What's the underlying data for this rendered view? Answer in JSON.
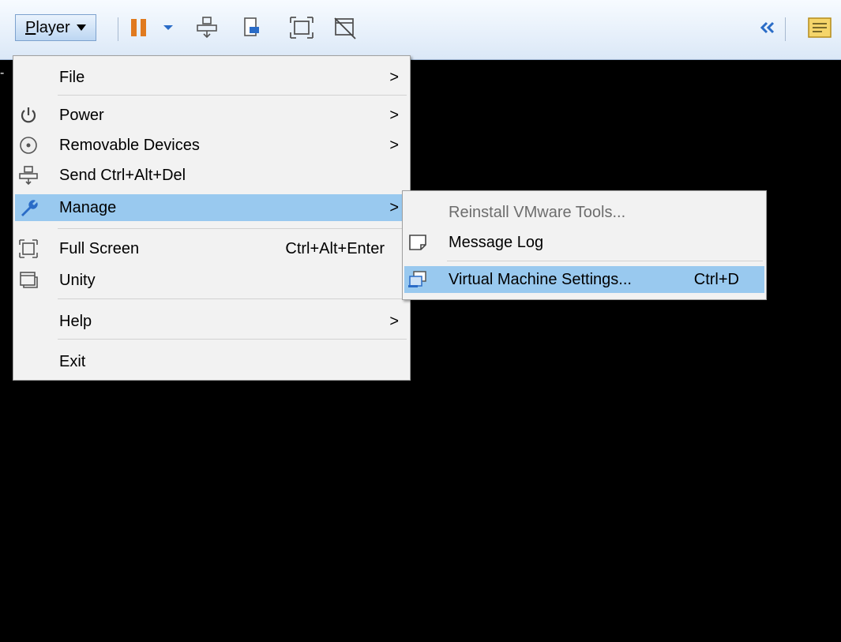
{
  "toolbar": {
    "player_label_first": "P",
    "player_label_rest": "layer",
    "icons": [
      "pause-icon",
      "dropdown-arrow-icon",
      "send-ctrl-alt-del-icon",
      "removable-devices-icon",
      "full-screen-icon",
      "unity-icon",
      "collapse-icon",
      "notes-icon"
    ],
    "accent": "#dbe8f7"
  },
  "main_menu": {
    "items": [
      {
        "label": "File",
        "arrow": ">",
        "icon": ""
      },
      {
        "label": "Power",
        "arrow": ">",
        "icon": "power-icon"
      },
      {
        "label": "Removable Devices",
        "arrow": ">",
        "icon": "disc-icon"
      },
      {
        "label": "Send Ctrl+Alt+Del",
        "arrow": "",
        "icon": "send-keys-icon"
      },
      {
        "label": "Manage",
        "arrow": ">",
        "icon": "wrench-icon"
      },
      {
        "label": "Full Screen",
        "shortcut": "Ctrl+Alt+Enter",
        "icon": "full-screen-icon"
      },
      {
        "label": "Unity",
        "arrow": "",
        "icon": "unity-icon"
      },
      {
        "label": "Help",
        "arrow": ">",
        "icon": ""
      },
      {
        "label": "Exit",
        "arrow": "",
        "icon": ""
      }
    ],
    "highlight_color": "#99c9ef"
  },
  "manage_submenu": {
    "items": [
      {
        "label": "Reinstall VMware Tools...",
        "disabled": true
      },
      {
        "label": "Message Log",
        "icon": "message-log-icon"
      },
      {
        "label": "Virtual Machine Settings...",
        "shortcut": "Ctrl+D",
        "icon": "vm-settings-icon"
      }
    ]
  },
  "left_marker": "-"
}
